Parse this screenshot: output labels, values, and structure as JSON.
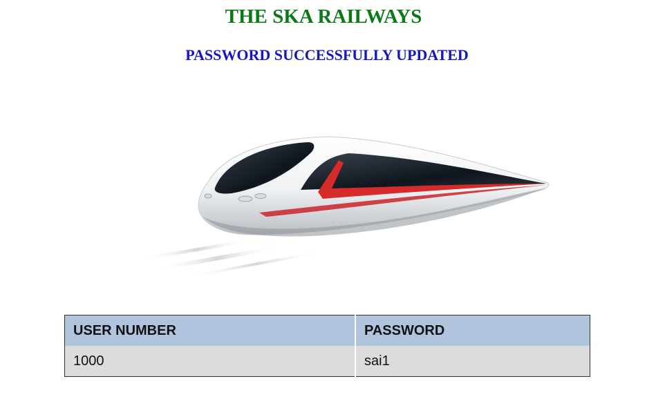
{
  "header": {
    "title": "THE SKA RAILWAYS",
    "message": "PASSWORD SUCCESSFULLY UPDATED"
  },
  "hero": {
    "icon": "train-image"
  },
  "table": {
    "columns": [
      "USER NUMBER",
      "PASSWORD"
    ],
    "rows": [
      [
        "1000",
        "sai1"
      ]
    ]
  },
  "colors": {
    "title": "#0b7a16",
    "message": "#1515c8",
    "header_row": "#b0c4de",
    "data_row": "#dcdcdc"
  }
}
